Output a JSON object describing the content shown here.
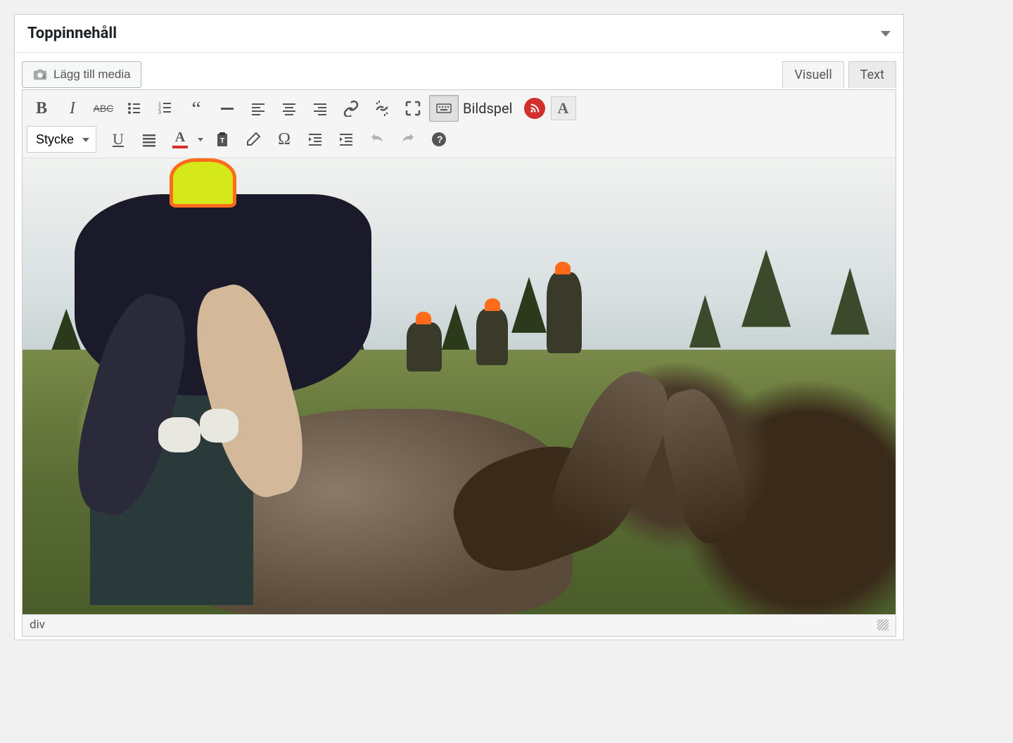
{
  "panel": {
    "title": "Toppinnehåll"
  },
  "media_button": {
    "label": "Lägg till media"
  },
  "tabs": {
    "visual": "Visuell",
    "text": "Text",
    "active": "visual"
  },
  "toolbar": {
    "row1": {
      "bold": "B",
      "italic": "I",
      "strikethrough": "ABC",
      "bildspel_label": "Bildspel",
      "textcolor_letter": "A"
    },
    "row2": {
      "format_select": "Stycke",
      "underline": "U",
      "textcolor_letter": "A"
    }
  },
  "content": {
    "image_description": "Hunter field-dressing a moose in a forest clearing with other hunters in background"
  },
  "statusbar": {
    "path": "div"
  }
}
